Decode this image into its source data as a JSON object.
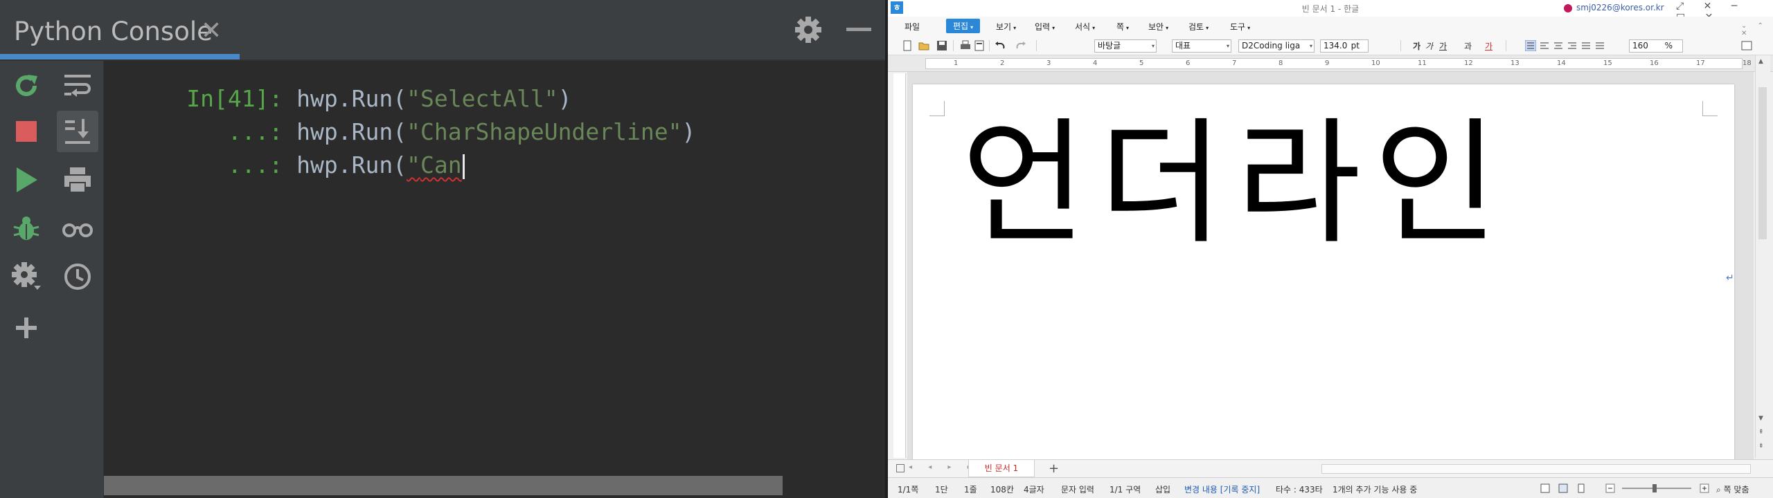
{
  "console": {
    "tab_title": "Python Console",
    "close_glyph": "✕",
    "header_icons": [
      "gear-icon",
      "minimize-icon"
    ],
    "toolbar_left": [
      "rerun-icon",
      "stop-icon",
      "run-icon",
      "debug-icon",
      "settings-icon",
      "add-icon"
    ],
    "toolbar_right": [
      "soft-wrap-icon",
      "scroll-to-end-icon",
      "print-icon",
      "show-variables-icon",
      "history-icon"
    ],
    "lines": [
      {
        "prompt": "In[41]:",
        "code_pre": "hwp.Run(",
        "string": "\"SelectAll\"",
        "code_post": ")"
      },
      {
        "prompt": "   ...:",
        "code_pre": "hwp.Run(",
        "string": "\"CharShapeUnderline\"",
        "code_post": ")"
      },
      {
        "prompt": "   ...:",
        "code_pre": "hwp.Run(",
        "string_quote": "\"",
        "string_typed": "Can"
      }
    ],
    "colors": {
      "bg": "#2b2b2b",
      "panel": "#3c3f41",
      "prompt": "#57a64a",
      "string": "#6a8759",
      "code": "#a9b7c6",
      "accent": "#4a88c7"
    }
  },
  "hwp": {
    "logo": "ㅎ",
    "window_title": "빈 문서 1 - 한글",
    "account": "smj0226@kores.or.kr",
    "window_buttons": "⤢ ✕ ─ □ ✕",
    "menus": [
      "파일",
      "편집",
      "보기",
      "입력",
      "서식",
      "쪽",
      "보안",
      "검토",
      "도구"
    ],
    "active_menu": "편집",
    "menubar_right": "⌄ ⌃ ✕",
    "toolbar": {
      "style": "바탕글",
      "lang": "대표",
      "font": "D2Coding liga",
      "size": "134.0",
      "size_unit": "pt",
      "bold": "가",
      "italic": "가",
      "underline": "가",
      "strike": "과",
      "color": "가",
      "zoom": "160",
      "zoom_unit": "%"
    },
    "ruler_numbers": [
      "1",
      "2",
      "3",
      "4",
      "5",
      "6",
      "7",
      "8",
      "9",
      "10",
      "11",
      "12",
      "13",
      "14",
      "15",
      "16",
      "17",
      "18"
    ],
    "document_text": "언더라인",
    "paragraph_mark": "↵",
    "doc_tab": "빈 문서 1",
    "add_tab": "+",
    "tab_nav": "◂ ◂ ▸ ▸",
    "status": {
      "page": "1/1쪽",
      "column": "1단",
      "line": "1줄",
      "col_pos": "108칸",
      "chars": "4글자",
      "input_mode": "문자 입력",
      "section": "1/1 구역",
      "insert": "삽입",
      "track": "변경 내용 [기록 중지]",
      "typing": "타수 : 433타",
      "extra": "1개의 추가 기능 사용 중",
      "fit": "쪽 맞춤"
    }
  }
}
